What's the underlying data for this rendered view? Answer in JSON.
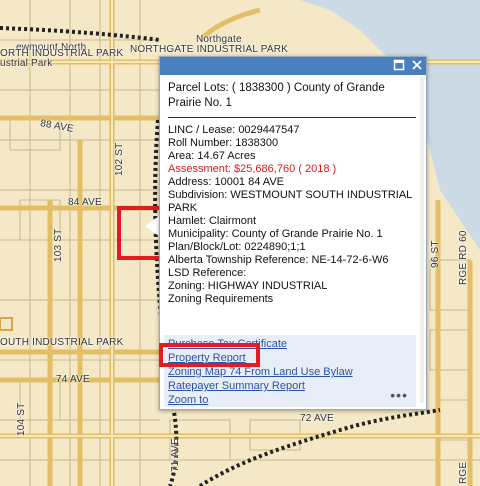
{
  "map": {
    "labels": {
      "northgate_ip": "NORTHGATE INDUSTRIAL PARK",
      "north_ip": "ORTH INDUSTRIAL PARK",
      "industrial_park_frag": "ustrial Park",
      "northgate": "Northgate",
      "west_north_frag": "ewmount North",
      "ave_88": "88 AVE",
      "st_102": "102 ST",
      "ave_84": "84 AVE",
      "st_103": "103 ST",
      "south_ip": "OUTH INDUSTRIAL PARK",
      "ave_74": "74 AVE",
      "ave_72": "72 AVE",
      "st_104": "104 ST",
      "rge_rd_60": "RGE RD 60",
      "rge": "RGE",
      "st_96": "96 ST",
      "ave_71": "71 AVE"
    }
  },
  "popup": {
    "title": "Parcel Lots: ( 1838300 ) County of Grande Prairie No. 1",
    "rows": [
      "LINC / Lease: 0029447547",
      "Roll Number: 1838300",
      "Area: 14.67 Acres",
      "Assessment: $25,686,760 ( 2018 )",
      "Address: 10001 84 AVE",
      "Subdivision: WESTMOUNT SOUTH INDUSTRIAL PARK",
      "Hamlet: Clairmont",
      "Municipality: County of Grande Prairie No. 1",
      "Plan/Block/Lot: 0224890;1;1",
      "Alberta Township Reference: NE-14-72-6-W6",
      "LSD Reference:",
      "Zoning: HIGHWAY INDUSTRIAL",
      "Zoning Requirements"
    ],
    "links": [
      "Purchase Tax Certificate",
      "Property Report",
      "Zoning Map 74 From Land Use Bylaw",
      "Ratepayer Summary Report",
      "Zoom to"
    ],
    "maximize_icon": "maximize-icon",
    "close_icon": "close-icon",
    "more_icon": "more-icon",
    "more_glyph": "•••"
  }
}
